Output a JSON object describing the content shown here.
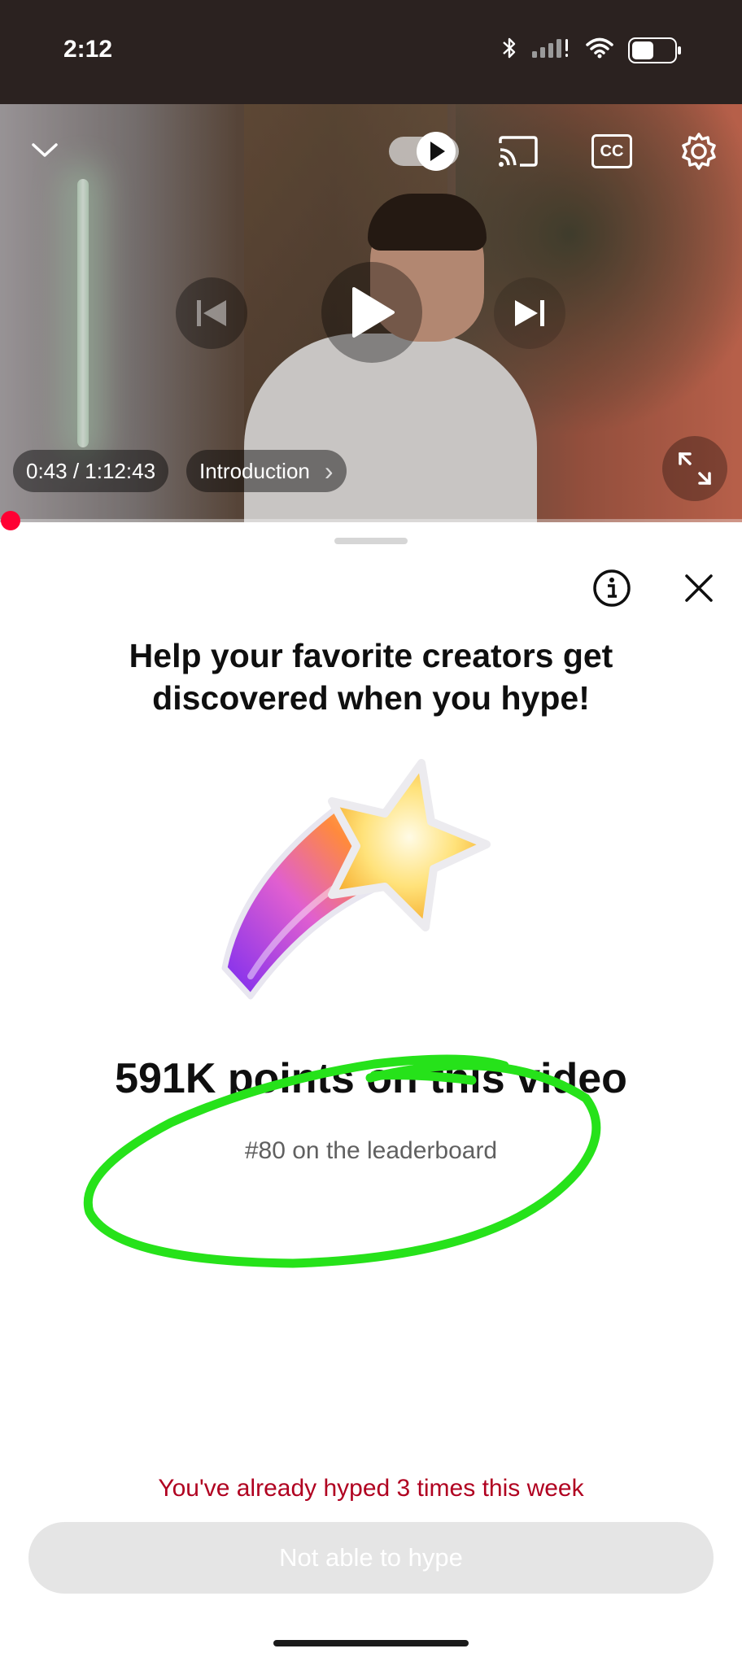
{
  "status_bar": {
    "time": "2:12"
  },
  "player": {
    "current_time": "0:43",
    "duration": "1:12:43",
    "time_separator": " / ",
    "chapter": "Introduction",
    "progress": 0.01,
    "icons": [
      "collapse-chevron-icon",
      "autoplay-toggle-icon",
      "cast-icon",
      "captions-icon",
      "settings-gear-icon",
      "previous-icon",
      "play-icon",
      "next-icon",
      "fullscreen-icon"
    ],
    "captions_label": "CC",
    "chapter_chevron": "›"
  },
  "sheet": {
    "headline": "Help your favorite creators get discovered when you hype!",
    "points_text": "591K points on this video",
    "rank_text": "#80 on the leaderboard",
    "warning_text": "You've already hyped 3 times this week",
    "button_label": "Not able to hype"
  },
  "colors": {
    "accent_red": "#ff0033",
    "warning_red": "#b00020",
    "annotation_green": "#26e21a",
    "disabled_button": "#e5e5e5"
  }
}
